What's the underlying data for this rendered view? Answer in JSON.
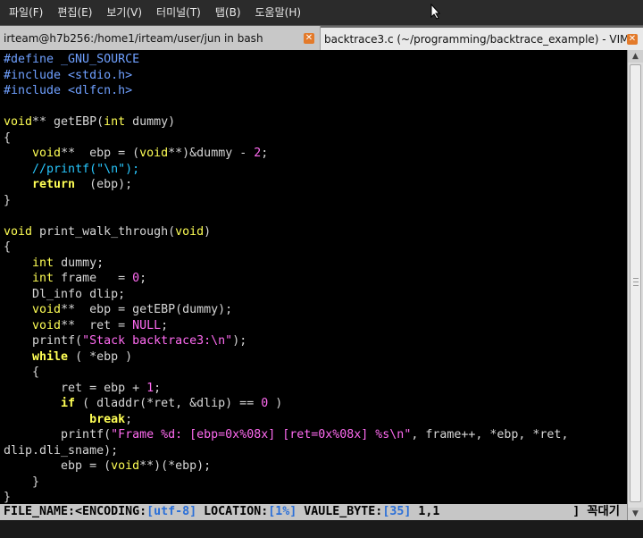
{
  "menubar": {
    "items": [
      "파일(F)",
      "편집(E)",
      "보기(V)",
      "터미널(T)",
      "탭(B)",
      "도움말(H)"
    ]
  },
  "tabs": [
    {
      "label": "irteam@h7b256:/home1/irteam/user/jun in bash",
      "active": false
    },
    {
      "label": "backtrace3.c (~/programming/backtrace_example) - VIM",
      "active": true
    }
  ],
  "code": [
    [
      [
        "pre",
        "#define _GNU_SOURCE"
      ]
    ],
    [
      [
        "pre",
        "#include <stdio.h>"
      ]
    ],
    [
      [
        "pre",
        "#include <dlfcn.h>"
      ]
    ],
    [],
    [
      [
        "type",
        "void"
      ],
      [
        "op",
        "** getEBP("
      ],
      [
        "type",
        "int"
      ],
      [
        "op",
        " dummy)"
      ]
    ],
    [
      [
        "op",
        "{"
      ]
    ],
    [
      [
        "op",
        "    "
      ],
      [
        "type",
        "void"
      ],
      [
        "op",
        "**  ebp = ("
      ],
      [
        "type",
        "void"
      ],
      [
        "op",
        "**)&dummy - "
      ],
      [
        "num",
        "2"
      ],
      [
        "op",
        ";"
      ]
    ],
    [
      [
        "op",
        "    "
      ],
      [
        "cmt",
        "//printf(\"\\n\");"
      ]
    ],
    [
      [
        "op",
        "    "
      ],
      [
        "kw",
        "return"
      ],
      [
        "op",
        "  (ebp);"
      ]
    ],
    [
      [
        "op",
        "}"
      ]
    ],
    [],
    [
      [
        "type",
        "void"
      ],
      [
        "op",
        " print_walk_through("
      ],
      [
        "type",
        "void"
      ],
      [
        "op",
        ")"
      ]
    ],
    [
      [
        "op",
        "{"
      ]
    ],
    [
      [
        "op",
        "    "
      ],
      [
        "type",
        "int"
      ],
      [
        "op",
        " dummy;"
      ]
    ],
    [
      [
        "op",
        "    "
      ],
      [
        "type",
        "int"
      ],
      [
        "op",
        " frame   = "
      ],
      [
        "num",
        "0"
      ],
      [
        "op",
        ";"
      ]
    ],
    [
      [
        "op",
        "    Dl_info dlip;"
      ]
    ],
    [
      [
        "op",
        "    "
      ],
      [
        "type",
        "void"
      ],
      [
        "op",
        "**  ebp = getEBP(dummy);"
      ]
    ],
    [
      [
        "op",
        "    "
      ],
      [
        "type",
        "void"
      ],
      [
        "op",
        "**  ret = "
      ],
      [
        "num",
        "NULL"
      ],
      [
        "op",
        ";"
      ]
    ],
    [
      [
        "op",
        "    printf("
      ],
      [
        "str",
        "\"Stack backtrace3:\\n\""
      ],
      [
        "op",
        ");"
      ]
    ],
    [
      [
        "op",
        "    "
      ],
      [
        "kw",
        "while"
      ],
      [
        "op",
        " ( *ebp )"
      ]
    ],
    [
      [
        "op",
        "    {"
      ]
    ],
    [
      [
        "op",
        "        ret = ebp + "
      ],
      [
        "num",
        "1"
      ],
      [
        "op",
        ";"
      ]
    ],
    [
      [
        "op",
        "        "
      ],
      [
        "kw",
        "if"
      ],
      [
        "op",
        " ( dladdr(*ret, &dlip) == "
      ],
      [
        "num",
        "0"
      ],
      [
        "op",
        " )"
      ]
    ],
    [
      [
        "op",
        "            "
      ],
      [
        "kw",
        "break"
      ],
      [
        "op",
        ";"
      ]
    ],
    [
      [
        "op",
        "        printf("
      ],
      [
        "str",
        "\"Frame %d: [ebp=0x%08x] [ret=0x%08x] %s\\n\""
      ],
      [
        "op",
        ", frame++, *ebp, *ret,"
      ]
    ],
    [
      [
        "op",
        "dlip.dli_sname);"
      ]
    ],
    [
      [
        "op",
        "        ebp = ("
      ],
      [
        "type",
        "void"
      ],
      [
        "op",
        "**)(*ebp);"
      ]
    ],
    [
      [
        "op",
        "    }"
      ]
    ],
    [
      [
        "op",
        "}"
      ]
    ]
  ],
  "status": {
    "file_label": "FILE_NAME:<ENCODING:",
    "encoding": "[utf-8]",
    "location_label": " LOCATION:",
    "location": "[1%]",
    "byte_label": " VAULE_BYTE:",
    "byte": "[35]",
    "position": " 1,1",
    "right": "] 꼭대기"
  }
}
